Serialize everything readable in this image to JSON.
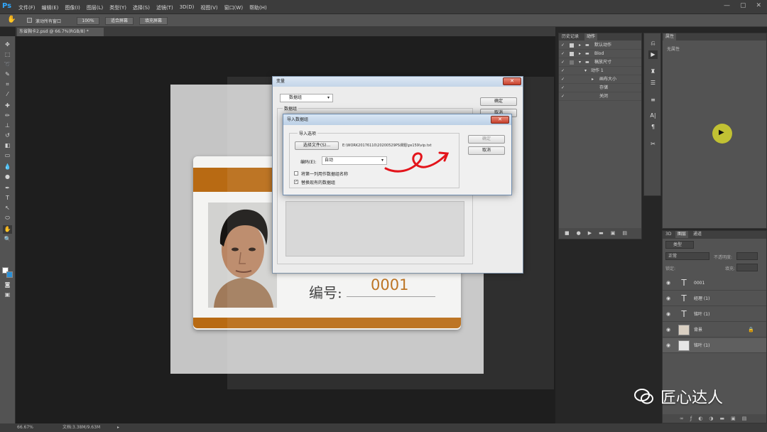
{
  "app": {
    "logo": "Ps",
    "menus": [
      "文件(F)",
      "编辑(E)",
      "图像(I)",
      "图层(L)",
      "类型(Y)",
      "选择(S)",
      "滤镜(T)",
      "3D(D)",
      "视图(V)",
      "窗口(W)",
      "帮助(H)"
    ],
    "window_controls": [
      "—",
      "▢",
      "✕"
    ]
  },
  "options_bar": {
    "scroll_all_label": "滚动所有窗口",
    "zoom_100": "100%",
    "fit_screen": "适合屏幕",
    "fill_screen": "填充屏幕"
  },
  "document": {
    "tab_title": "东省胸卡2.psd @ 66.7%(RGB/8) *",
    "card_id_label": "编号:",
    "card_id_value": "0001"
  },
  "outer_dialog": {
    "title": "变量",
    "dropdown": "数据组",
    "group_label": "数据组",
    "ok": "确定",
    "cancel": "取消"
  },
  "import_dialog": {
    "title": "导入数据组",
    "group_label": "导入选项",
    "choose_file": "选择文件(S)...",
    "file_path": "E:\\WORK20176110\\20200529PS课题\\ps159\\vip.txt",
    "encoding_label": "编码(E):",
    "encoding_value": "自动",
    "option1": "将第一列用作数据组名称",
    "option2": "替换现有的数据组",
    "ok": "确定",
    "cancel": "取消"
  },
  "history_panel": {
    "tabs": [
      "历史记录",
      "动作"
    ],
    "rows": [
      "默认动作",
      "Blod",
      "稿放尺寸",
      "动作 1",
      "画布大小",
      "存储",
      "关闭"
    ]
  },
  "properties_panel": {
    "tab": "属性",
    "empty_text": "无属性"
  },
  "layers_panel": {
    "tabs": [
      "3D",
      "图层",
      "通道"
    ],
    "kind_label": "类型",
    "blend_mode": "正常",
    "opacity_label": "不透明度:",
    "lock_label": "锁定:",
    "fill_label": "填充:",
    "layers": [
      {
        "name": "0001",
        "thumb": "T"
      },
      {
        "name": "经理 (1)",
        "thumb": "T"
      },
      {
        "name": "铭叶 (1)",
        "thumb": "T"
      },
      {
        "name": "背景",
        "thumb": "img"
      },
      {
        "name": "铭叶 (1)",
        "thumb": "img"
      }
    ]
  },
  "status_bar": {
    "zoom": "66.67%",
    "doc_info": "文档:3.38M/9.63M"
  },
  "watermark": "匠心达人"
}
